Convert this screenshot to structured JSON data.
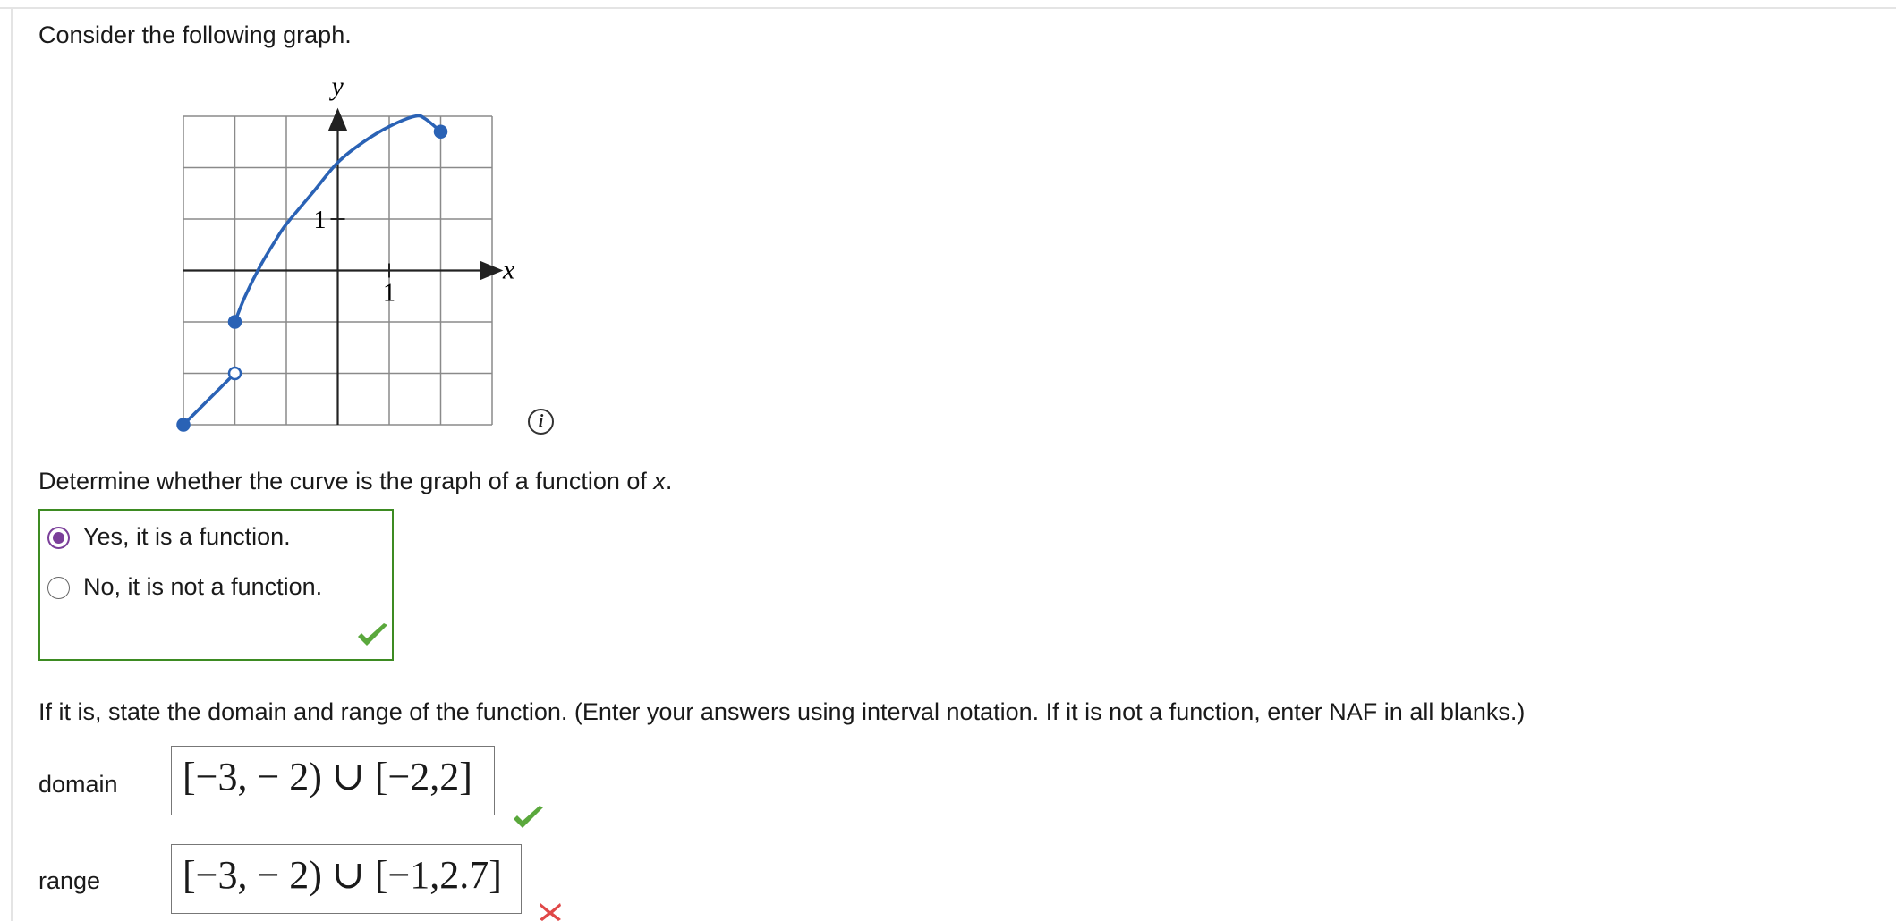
{
  "question": {
    "prompt": "Consider the following graph.",
    "function_question": "Determine whether the curve is the graph of a function of ",
    "function_var": "x",
    "function_end": ".",
    "domain_range_prompt": "If it is, state the domain and range of the function. (Enter your answers using interval notation. If it is not a function, enter NAF in all blanks.)"
  },
  "graph": {
    "x_axis_label": "x",
    "y_axis_label": "y",
    "x_tick_label": "1",
    "y_tick_label": "1",
    "curve_color": "#2a62b5",
    "info_icon_glyph": "i",
    "info_icon": "info-circle-icon"
  },
  "chart_data": {
    "type": "line",
    "xlabel": "x",
    "ylabel": "y",
    "xlim": [
      -3,
      3
    ],
    "ylim": [
      -3,
      3
    ],
    "grid": true,
    "series": [
      {
        "segment": "lower",
        "x": [
          -3,
          -2
        ],
        "y": [
          -3,
          -2
        ],
        "endpoints": [
          {
            "x": -3,
            "y": -3,
            "closed": true
          },
          {
            "x": -2,
            "y": -2,
            "closed": false
          }
        ]
      },
      {
        "segment": "upper",
        "x": [
          -2,
          -1.8,
          -1.5,
          -1.2,
          -1,
          -0.5,
          0,
          0.5,
          1,
          1.5,
          1.7,
          2
        ],
        "y": [
          -1,
          -0.5,
          0.1,
          0.6,
          0.9,
          1.5,
          2.1,
          2.5,
          2.8,
          3,
          2.95,
          2.7
        ],
        "endpoints": [
          {
            "x": -2,
            "y": -1,
            "closed": true
          },
          {
            "x": 2,
            "y": 2.7,
            "closed": true
          }
        ]
      }
    ]
  },
  "function_choices": {
    "options": [
      {
        "label": "Yes, it is a function.",
        "selected": true
      },
      {
        "label": "No, it is not a function.",
        "selected": false
      }
    ],
    "status": "correct",
    "status_icon": "checkmark-icon"
  },
  "domain": {
    "label": "domain",
    "value": "[−3, − 2) ∪ [−2,2]",
    "status": "correct",
    "status_icon": "checkmark-icon"
  },
  "range": {
    "label": "range",
    "value": "[−3, − 2) ∪ [−1,2.7]",
    "status": "incorrect",
    "status_icon": "x-mark-icon"
  },
  "colors": {
    "correct_green": "#5aa83c",
    "incorrect_red": "#e04848",
    "choice_border": "#3d8b22",
    "radio_selected": "#7b3f9a"
  }
}
